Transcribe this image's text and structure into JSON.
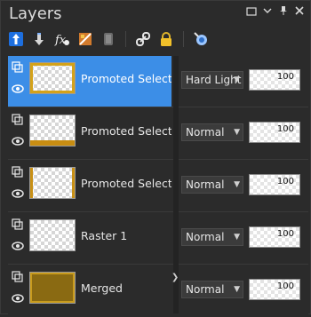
{
  "panel": {
    "title": "Layers"
  },
  "window_controls": [
    "minimize-icon",
    "pin-icon",
    "close-icon"
  ],
  "toolbar": {
    "icons": [
      "new-raster-layer-icon",
      "new-mask-layer-icon",
      "layer-effects-icon",
      "edit-selection-icon",
      "layer-group-icon",
      "link-layers-icon",
      "lock-transparency-icon",
      "highlight-icon"
    ]
  },
  "layers": [
    {
      "name": "Promoted Selection",
      "blend": "Hard Light",
      "opacity": 100,
      "selected": true,
      "thumb": "gold-frame"
    },
    {
      "name": "Promoted Selection",
      "blend": "Normal",
      "opacity": 100,
      "selected": false,
      "thumb": "gold-bottom"
    },
    {
      "name": "Promoted Selection",
      "blend": "Normal",
      "opacity": 100,
      "selected": false,
      "thumb": "gold-sides"
    },
    {
      "name": "Raster 1",
      "blend": "Normal",
      "opacity": 100,
      "selected": false,
      "thumb": "transparent"
    },
    {
      "name": "Merged",
      "blend": "Normal",
      "opacity": 100,
      "selected": false,
      "thumb": "merged"
    }
  ],
  "colors": {
    "selected": "#3c8ee7",
    "panel_bg": "#2b2b2b"
  }
}
